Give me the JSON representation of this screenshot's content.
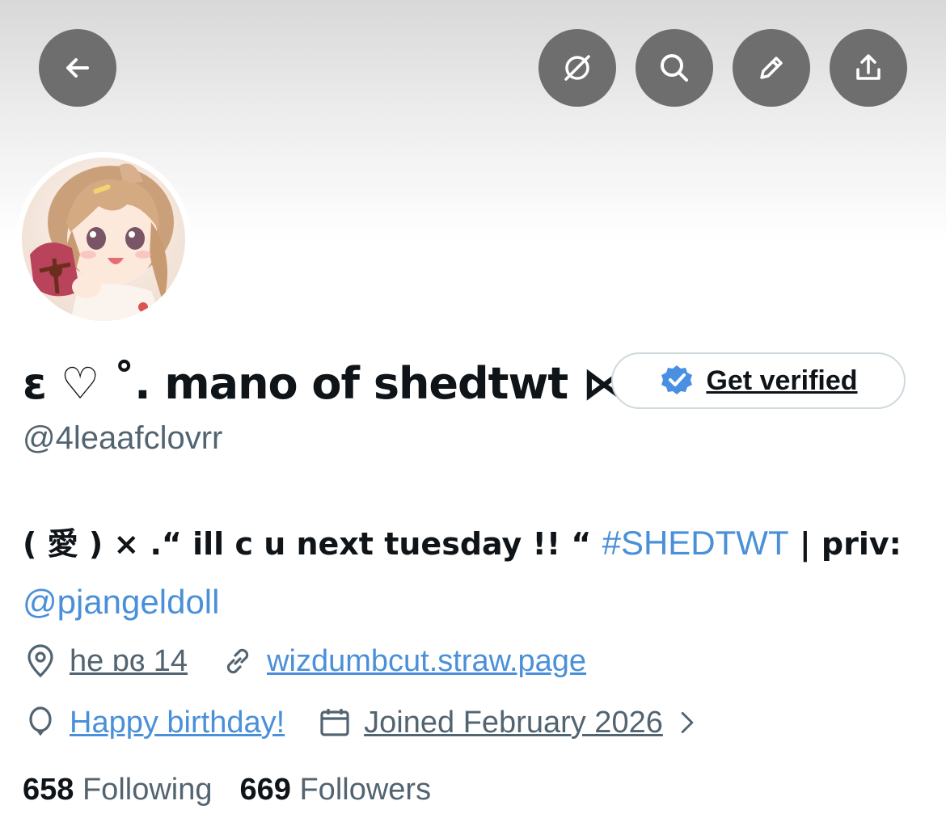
{
  "header": {
    "back_icon": "arrow-left-icon",
    "grok_icon": "grok-icon",
    "search_icon": "search-icon",
    "edit_icon": "pencil-icon",
    "share_icon": "share-icon"
  },
  "profile": {
    "display_name": "ɛ ♡ ˚. mano of shedtwt ⋈",
    "handle": "@4leaafclovrr",
    "verify_label": "Get verified",
    "bio_text": "( 愛 ) ⨯ .“ ill c u next tuesday !! “ ",
    "bio_hashtag": "#SHEDTWT",
    "bio_after": " | priv: ",
    "bio_mention": "@pjangeldoll",
    "location": "he   ɒɞ   14",
    "website": "wizdumbcut.straw.page",
    "birthday": "Happy birthday!",
    "joined": "Joined February 2026"
  },
  "stats": {
    "following_count": "658",
    "following_label": "Following",
    "followers_count": "669",
    "followers_label": "Followers"
  },
  "colors": {
    "link": "#4a90d9",
    "secondary": "#536471",
    "button_bg": "#6e6e6e",
    "verified_badge": "#4a90e2"
  }
}
